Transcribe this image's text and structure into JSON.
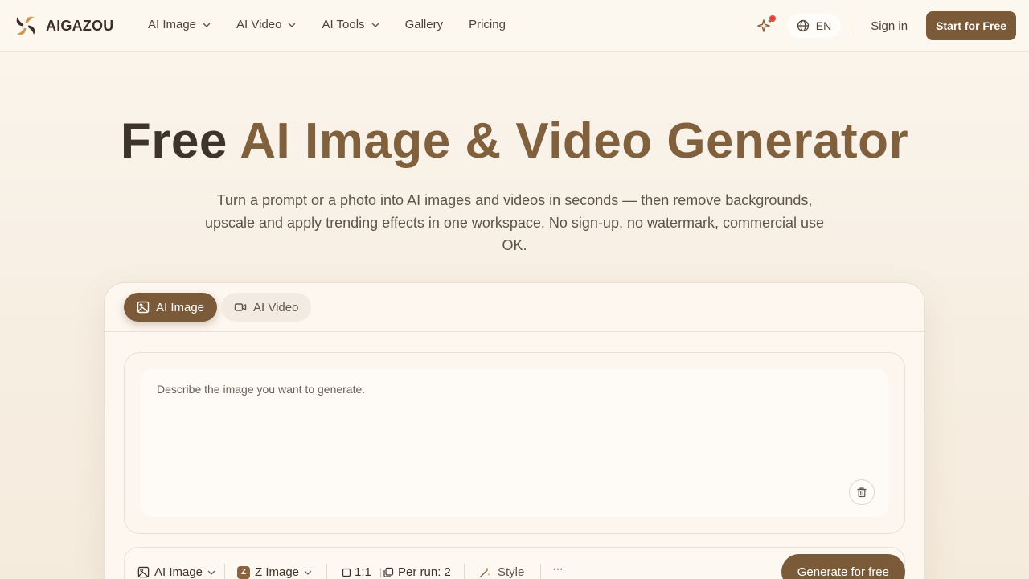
{
  "brand": {
    "name": "AIGAZOU"
  },
  "nav": {
    "items": [
      {
        "label": "AI Image",
        "dropdown": true
      },
      {
        "label": "AI Video",
        "dropdown": true
      },
      {
        "label": "AI Tools",
        "dropdown": true
      },
      {
        "label": "Gallery",
        "dropdown": false
      },
      {
        "label": "Pricing",
        "dropdown": false
      }
    ]
  },
  "header_tools": {
    "language": "EN",
    "sign_in": "Sign in",
    "start_cta": "Start for Free",
    "notification_dot_color": "#e5483b"
  },
  "hero": {
    "title_plain": "Free",
    "title_accent": "AI Image & Video Generator",
    "subtitle": "Turn a prompt or a photo into AI images and videos in seconds — then remove backgrounds, upscale and apply trending effects in one workspace. No sign-up, no watermark, commercial use OK."
  },
  "workspace": {
    "tabs": [
      {
        "label": "AI Image",
        "active": true,
        "icon": "image-icon"
      },
      {
        "label": "AI Video",
        "active": false,
        "icon": "video-icon"
      }
    ],
    "prompt": {
      "placeholder": "Describe the image you want to generate.",
      "value": ""
    },
    "toolbar": {
      "mode": "AI Image",
      "model_badge": "Z",
      "model": "Z Image",
      "ratio": "1:1",
      "ratio_sep": "|",
      "per_run": "Per run: 2",
      "style": "Style",
      "more": "···",
      "generate": "Generate for free"
    }
  },
  "colors": {
    "accent": "#7a5a38",
    "accent_text": "#80603d",
    "title_dark": "#3f3429",
    "background": "#fbf5ec"
  }
}
